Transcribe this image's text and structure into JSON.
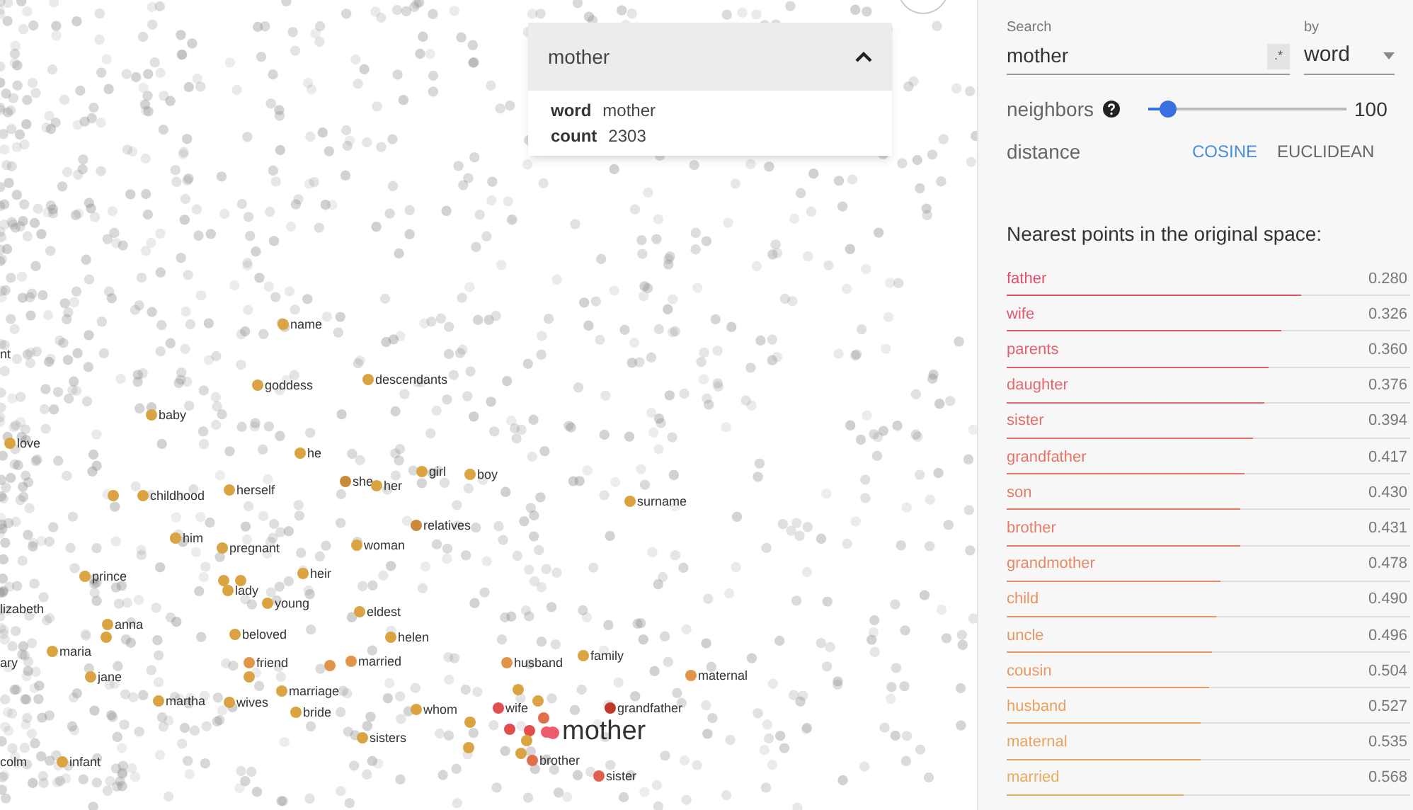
{
  "canvas": {
    "points": [
      {
        "label": "nt"
      },
      {
        "label": "name",
        "color": "#d9a441"
      },
      {
        "label": "goddess",
        "color": "#d9a441"
      },
      {
        "label": "descendants",
        "color": "#d9a441"
      },
      {
        "label": "baby",
        "color": "#d9a441"
      },
      {
        "label": "love",
        "color": "#d9a441"
      },
      {
        "label": "he",
        "color": "#d9a441"
      },
      {
        "label": "girl",
        "color": "#d9a441"
      },
      {
        "label": "boy",
        "color": "#d9a441"
      },
      {
        "label": "childhood",
        "color": "#d9a441"
      },
      {
        "label": "herself",
        "color": "#d9a441"
      },
      {
        "label": "she",
        "color": "#c98a3a"
      },
      {
        "label": "her",
        "color": "#d9a441"
      },
      {
        "label": "surname",
        "color": "#d9a441"
      },
      {
        "label": "relatives",
        "color": "#c98a3a"
      },
      {
        "label": "him",
        "color": "#d9a441"
      },
      {
        "label": "pregnant",
        "color": "#d9a441"
      },
      {
        "label": "woman",
        "color": "#d9a441"
      },
      {
        "label": "prince",
        "color": "#d9a441"
      },
      {
        "label": "heir",
        "color": "#d9a441"
      },
      {
        "label": "lady",
        "color": "#d9a441"
      },
      {
        "label": "young",
        "color": "#d9a441"
      },
      {
        "label": "lizabeth"
      },
      {
        "label": "eldest",
        "color": "#d9a441"
      },
      {
        "label": "anna",
        "color": "#d9a441"
      },
      {
        "label": "beloved",
        "color": "#d9a441"
      },
      {
        "label": "helen",
        "color": "#d9a441"
      },
      {
        "label": "maria",
        "color": "#d9a441"
      },
      {
        "label": "friend",
        "color": "#e0954a"
      },
      {
        "label": "married",
        "color": "#e0954a"
      },
      {
        "label": "husband",
        "color": "#e0954a"
      },
      {
        "label": "family",
        "color": "#d9a441"
      },
      {
        "label": "maternal",
        "color": "#e0954a"
      },
      {
        "label": "ary"
      },
      {
        "label": "jane",
        "color": "#d9a441"
      },
      {
        "label": "marriage",
        "color": "#d9a441"
      },
      {
        "label": "martha",
        "color": "#d9a441"
      },
      {
        "label": "wives",
        "color": "#d9a441"
      },
      {
        "label": "bride",
        "color": "#d9a441"
      },
      {
        "label": "whom",
        "color": "#d9a441"
      },
      {
        "label": "wife",
        "color": "#e24e4e"
      },
      {
        "label": "grandfather",
        "color": "#c0392b"
      },
      {
        "label": "sisters",
        "color": "#d9a441"
      },
      {
        "label": "brother",
        "color": "#e0704a"
      },
      {
        "label": "sister",
        "color": "#e0604e"
      },
      {
        "label": "colm"
      },
      {
        "label": "infant",
        "color": "#d9a441"
      }
    ],
    "focus": {
      "label": "mother",
      "color": "#ee5a6e"
    }
  },
  "info_card": {
    "title": "mother",
    "expanded": true,
    "fields": [
      {
        "key": "word",
        "value": "mother"
      },
      {
        "key": "count",
        "value": "2303"
      }
    ]
  },
  "search": {
    "label": "Search",
    "value": "mother",
    "regex_button": ".*",
    "by_label": "by",
    "by_value": "word"
  },
  "neighbors": {
    "label": "neighbors",
    "level": 0.1,
    "reading": "100"
  },
  "distance": {
    "label": "distance",
    "options": [
      {
        "label": "COSINE",
        "selected": true
      },
      {
        "label": "EUCLIDEAN",
        "selected": false
      }
    ]
  },
  "nearest": {
    "title": "Nearest points in the original space:",
    "items": [
      {
        "word": "father",
        "distance": "0.280",
        "level": 0.73,
        "color": "#e0506a"
      },
      {
        "word": "wife",
        "distance": "0.326",
        "level": 0.68,
        "color": "#e2586c"
      },
      {
        "word": "parents",
        "distance": "0.360",
        "level": 0.65,
        "color": "#e3606c"
      },
      {
        "word": "daughter",
        "distance": "0.376",
        "level": 0.64,
        "color": "#e4686a"
      },
      {
        "word": "sister",
        "distance": "0.394",
        "level": 0.61,
        "color": "#e56f68"
      },
      {
        "word": "grandfather",
        "distance": "0.417",
        "level": 0.59,
        "color": "#e67566"
      },
      {
        "word": "son",
        "distance": "0.430",
        "level": 0.58,
        "color": "#e77c66"
      },
      {
        "word": "brother",
        "distance": "0.431",
        "level": 0.58,
        "color": "#e77c66"
      },
      {
        "word": "grandmother",
        "distance": "0.478",
        "level": 0.53,
        "color": "#e88a64"
      },
      {
        "word": "child",
        "distance": "0.490",
        "level": 0.52,
        "color": "#e99262"
      },
      {
        "word": "uncle",
        "distance": "0.496",
        "level": 0.51,
        "color": "#e99662"
      },
      {
        "word": "cousin",
        "distance": "0.504",
        "level": 0.5,
        "color": "#ea9a60"
      },
      {
        "word": "husband",
        "distance": "0.527",
        "level": 0.48,
        "color": "#eba05e"
      },
      {
        "word": "maternal",
        "distance": "0.535",
        "level": 0.48,
        "color": "#eba45e"
      },
      {
        "word": "married",
        "distance": "0.568",
        "level": 0.44,
        "color": "#ecaa5e"
      }
    ]
  }
}
